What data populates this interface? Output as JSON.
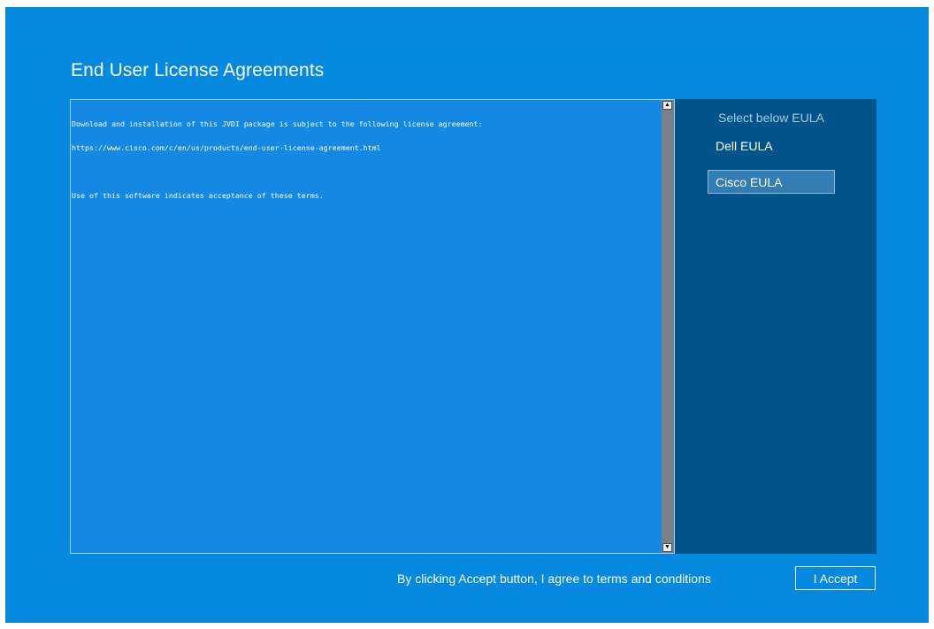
{
  "window": {
    "title": "End User License Agreements"
  },
  "eula_text": {
    "line1": "Download and installation of this JVDI package is subject to the following license agreement:",
    "line2": "https://www.cisco.com/c/en/us/products/end-user-license-agreement.html",
    "line3": "Use of this software indicates acceptance of these terms."
  },
  "scrollbar": {
    "up_arrow": "▲",
    "down_arrow": "▼"
  },
  "side_panel": {
    "header": "Select below EULA",
    "items": [
      {
        "label": "Dell EULA",
        "selected": false
      },
      {
        "label": "Cisco EULA",
        "selected": true
      }
    ]
  },
  "footer": {
    "agreement_text": "By clicking Accept button, I agree to terms and conditions",
    "accept_label": "I Accept"
  },
  "colors": {
    "background": "#0489df",
    "text_area": "#1488e3",
    "side_panel": "#015489",
    "selected_item": "#347db3"
  }
}
